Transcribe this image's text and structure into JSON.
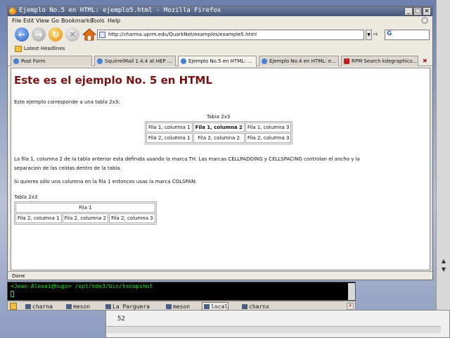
{
  "window": {
    "title": "Ejemplo No.5 en HTML: ejemplo5.html - Mozilla Firefox"
  },
  "menu": [
    "File",
    "Edit",
    "View",
    "Go",
    "Bookmarks",
    "Tools",
    "Help"
  ],
  "nav": {
    "url": "http://charma.uprm.edu/QuarkNet/examples/example5.html",
    "search_value": ""
  },
  "bookmarks": {
    "latest_headlines": "Latest Headlines"
  },
  "tabs": [
    {
      "label": "Post Form"
    },
    {
      "label": "SquirrelMail 1.4.4 at HEP ..."
    },
    {
      "label": "Ejemplo No.5 en HTML: ..."
    },
    {
      "label": "Ejemplo No.4 en HTML: e..."
    },
    {
      "label": "RPM Search kdegraphics..."
    }
  ],
  "page": {
    "heading": "Este es el ejemplo No. 5 en HTML",
    "intro": "Este ejemplo corresponde a una tabla 2x3:",
    "table1": {
      "caption": "Tabla 2x3",
      "rows": [
        [
          "Fila 1, columna 1",
          "Fila 1, columna 2",
          "Fila 1, columna 3"
        ],
        [
          "Fila 2, columna 1",
          "Fila 2, columna 2",
          "Fila 2, columna 3"
        ]
      ]
    },
    "para1_line1": "La fila 1, columna 2 de la tabla anterior esta definida usando la marca TH. Las marcas CELLPADDING y CELLSPACING controlan el ancho y la",
    "para1_line2": "separacion de las celdas dentro de la tabla.",
    "para2": "Si quieres sólo una columna en la fila 1 entonces usas la marca COLSPAN:",
    "table2": {
      "caption": "Tabla 2x3",
      "row1": "Fila 1",
      "row2": [
        "Fila 2, columna 1",
        "Fila 2, columna 2",
        "Fila 2, columna 3"
      ]
    }
  },
  "status": "Done",
  "terminal": {
    "line": "<Jean-Alexei@hugo> /opt/kde3/bin/ksnapshot"
  },
  "taskbar": [
    "charna",
    "meson",
    "La Parguera",
    "meson",
    "local",
    "charnx"
  ],
  "background_window": {
    "number": "52"
  }
}
